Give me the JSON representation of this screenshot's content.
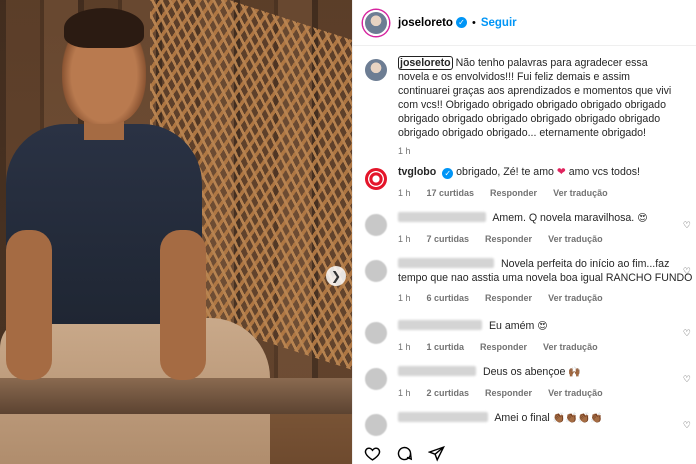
{
  "post": {
    "username": "joseloreto",
    "follow_label": "Seguir",
    "caption_user": "joseloreto",
    "caption_text": "Não tenho palavras para agradecer essa novela e os envolvidos!!! Fui feliz demais e assim continuarei graças aos aprendizados e momentos que vivi com vcs!! Obrigado obrigado obrigado obrigado obrigado obrigado obrigado obrigado obrigado obrigado obrigado obrigado obrigado obrigado... eternamente obrigado!",
    "caption_time": "1 h"
  },
  "comments": [
    {
      "user": "tvglobo",
      "verified": true,
      "text": "obrigado, Zé! te amo",
      "text_after": "amo vcs todos!",
      "time": "1 h",
      "likes": "17 curtidas",
      "reply": "Responder",
      "translate": "Ver tradução"
    },
    {
      "user": "",
      "text": "Amem. Q novela maravilhosa.",
      "emoji": "😍",
      "time": "1 h",
      "likes": "7 curtidas",
      "reply": "Responder",
      "translate": "Ver tradução"
    },
    {
      "user": "",
      "text": "Novela perfeita do início ao fim...faz tempo que nao asstia uma novela boa igual RANCHO FUNDO",
      "time": "1 h",
      "likes": "6 curtidas",
      "reply": "Responder",
      "translate": "Ver tradução"
    },
    {
      "user": "",
      "text": "Eu amém",
      "emoji": "😍",
      "time": "1 h",
      "likes": "1 curtida",
      "reply": "Responder",
      "translate": "Ver tradução"
    },
    {
      "user": "",
      "text": "Deus os abençoe",
      "emoji": "🙌🏾",
      "time": "1 h",
      "likes": "2 curtidas",
      "reply": "Responder",
      "translate": "Ver tradução"
    },
    {
      "user": "",
      "text": "Amei o final",
      "emoji": "👏🏾👏🏾👏🏾👏🏾",
      "time": "",
      "likes": "",
      "reply": "",
      "translate": ""
    }
  ],
  "icons": {
    "like": "heart-outline-icon",
    "comment": "comment-icon",
    "share": "send-icon",
    "next": "chevron-right-icon"
  }
}
